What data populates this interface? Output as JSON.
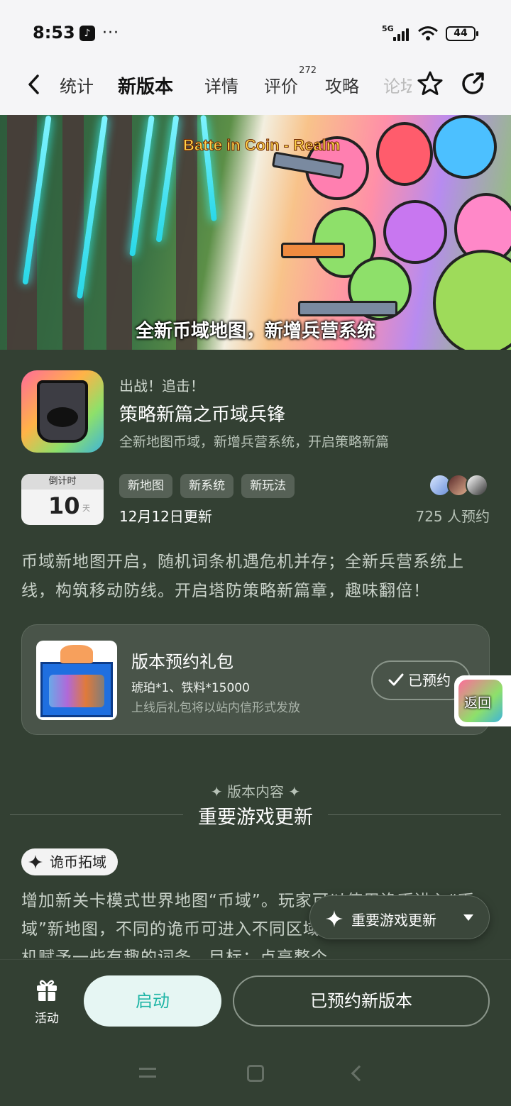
{
  "status_bar": {
    "time": "8:53",
    "app_glyph": "♪",
    "overflow": "···",
    "network": "5G",
    "battery": "44"
  },
  "tabs": [
    {
      "label": "统计"
    },
    {
      "label": "新版本"
    },
    {
      "label": "详情"
    },
    {
      "label": "评价",
      "count": "272"
    },
    {
      "label": "攻略"
    },
    {
      "label": "论坛"
    }
  ],
  "banner": {
    "logo_text": "Batte in Coin - Realm",
    "caption": "全新币域地图，新增兵营系统"
  },
  "game": {
    "tagline": "出战！追击！",
    "title": "策略新篇之币域兵锋",
    "subtitle": "全新地图币域，新增兵营系统，开启策略新篇",
    "countdown_label": "倒计时",
    "countdown_value": "10",
    "countdown_unit": "天",
    "chips": [
      "新地图",
      "新系统",
      "新玩法"
    ],
    "update_date": "12月12日更新",
    "reserve_count": "725 人预约",
    "description": "币域新地图开启，随机词条机遇危机并存；全新兵营系统上线，构筑移动防线。开启塔防策略新篇章，趣味翻倍！"
  },
  "gift": {
    "title": "版本预约礼包",
    "items": "琥珀*1、铁料*15000",
    "note": "上线后礼包将以站内信形式发放",
    "button": "已预约"
  },
  "floating_return": {
    "label": "返回"
  },
  "section": {
    "subheading": "✦ 版本内容 ✦",
    "title": "重要游戏更新",
    "pill": "诡币拓域",
    "body": "增加新关卡模式世界地图“币域”。玩家可以使用诡币进入“币域”新地图，不同的诡币可进入不同区域，根据稀有度会被随机赋予一些有趣的词条。目标：点亮整个"
  },
  "floating_section": {
    "label": "重要游戏更新"
  },
  "bottom": {
    "activity_label": "活动",
    "launch": "启动",
    "reserved_new": "已预约新版本"
  },
  "colors": {
    "background": "#334033",
    "accent": "#23c4b4",
    "header": "#f5f5f7"
  }
}
